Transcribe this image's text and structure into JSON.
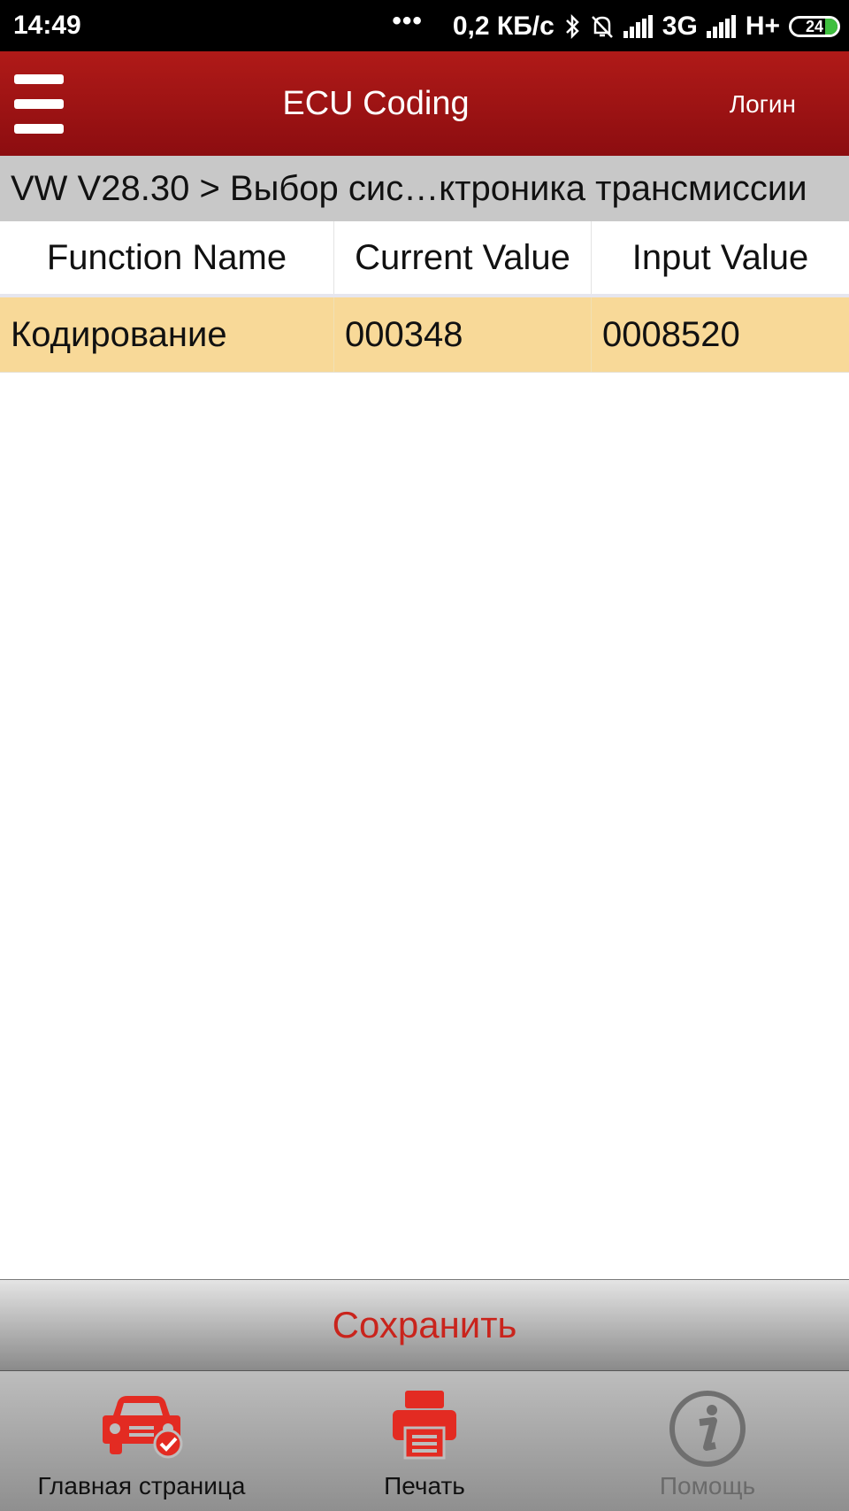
{
  "status_bar": {
    "time": "14:49",
    "dots": "•••",
    "network_speed": "0,2 КБ/с",
    "net_3g": "3G",
    "net_hplus": "H+",
    "battery": "24"
  },
  "app_bar": {
    "title": "ECU Coding",
    "login": "Логин"
  },
  "breadcrumb": "VW V28.30 > Выбор сис…ктроника трансмиссии",
  "table": {
    "headers": [
      "Function Name",
      "Current Value",
      "Input Value"
    ],
    "rows": [
      [
        "Кодирование",
        "000348",
        "0008520"
      ]
    ]
  },
  "save_label": "Сохранить",
  "bottom_nav": [
    {
      "label": "Главная страница",
      "icon": "car-check-icon"
    },
    {
      "label": "Печать",
      "icon": "printer-icon"
    },
    {
      "label": "Помощь",
      "icon": "info-icon"
    }
  ],
  "colors": {
    "accent": "#a61414",
    "row_highlight": "#f8d998",
    "save_text": "#c9241c"
  }
}
